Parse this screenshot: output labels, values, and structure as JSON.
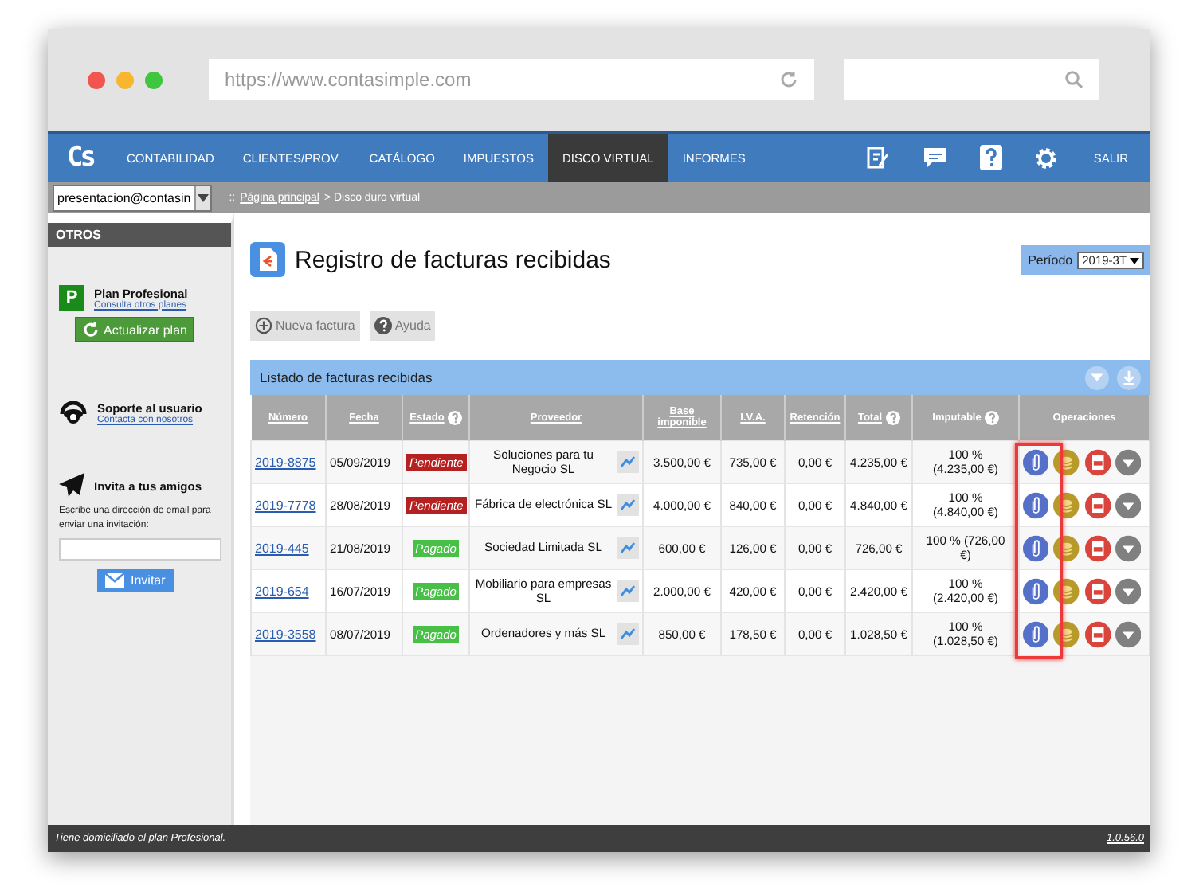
{
  "browser": {
    "url": "https://www.contasimple.com"
  },
  "nav": {
    "logo": "Cs",
    "items": [
      {
        "label": "CONTABILIDAD",
        "selected": false
      },
      {
        "label": "CLIENTES/PROV.",
        "selected": false
      },
      {
        "label": "CATÁLOGO",
        "selected": false
      },
      {
        "label": "IMPUESTOS",
        "selected": false
      },
      {
        "label": "DISCO VIRTUAL",
        "selected": true
      },
      {
        "label": "INFORMES",
        "selected": false
      }
    ],
    "logout": "SALIR"
  },
  "account": "presentacion@contasin",
  "breadcrumb": {
    "prefix": "::",
    "link": "Página principal",
    "rest": "> Disco duro virtual"
  },
  "sidebar": {
    "title": "OTROS",
    "plan": {
      "badge": "P",
      "title": "Plan Profesional",
      "link": "Consulta otros planes",
      "button": "Actualizar plan"
    },
    "support": {
      "title": "Soporte al usuario",
      "link": "Contacta con nosotros"
    },
    "invite": {
      "title": "Invita a tus amigos",
      "text": "Escribe una dirección de email para enviar una invitación:",
      "button": "Invitar"
    }
  },
  "page": {
    "title": "Registro de facturas recibidas",
    "period_label": "Período",
    "period": "2019-3T",
    "actions": [
      "Nueva factura",
      "Ayuda"
    ],
    "list_title": "Listado de facturas recibidas"
  },
  "table": {
    "columns": [
      {
        "label": "Número",
        "help": false
      },
      {
        "label": "Fecha",
        "help": false
      },
      {
        "label": "Estado",
        "help": true
      },
      {
        "label": "Proveedor",
        "help": false
      },
      {
        "label": "Base imponible",
        "help": false
      },
      {
        "label": "I.V.A.",
        "help": false
      },
      {
        "label": "Retención",
        "help": false
      },
      {
        "label": "Total",
        "help": true
      },
      {
        "label": "Imputable",
        "help": true
      },
      {
        "label": "Operaciones",
        "help": false
      }
    ],
    "rows": [
      {
        "number": "2019-8875",
        "date": "05/09/2019",
        "status": "Pendiente",
        "kind": "pending",
        "supplier": "Soluciones para tu Negocio SL",
        "base": "3.500,00 €",
        "iva": "735,00 €",
        "retention": "0,00 €",
        "total": "4.235,00 €",
        "imputable": "100 % (4.235,00 €)"
      },
      {
        "number": "2019-7778",
        "date": "28/08/2019",
        "status": "Pendiente",
        "kind": "pending",
        "supplier": "Fábrica de electrónica SL",
        "base": "4.000,00 €",
        "iva": "840,00 €",
        "retention": "0,00 €",
        "total": "4.840,00 €",
        "imputable": "100 % (4.840,00 €)"
      },
      {
        "number": "2019-445",
        "date": "21/08/2019",
        "status": "Pagado",
        "kind": "paid",
        "supplier": "Sociedad Limitada SL",
        "base": "600,00 €",
        "iva": "126,00 €",
        "retention": "0,00 €",
        "total": "726,00 €",
        "imputable": "100 %  (726,00 €)"
      },
      {
        "number": "2019-654",
        "date": "16/07/2019",
        "status": "Pagado",
        "kind": "paid",
        "supplier": "Mobiliario para empresas SL",
        "base": "2.000,00 €",
        "iva": "420,00 €",
        "retention": "0,00 €",
        "total": "2.420,00 €",
        "imputable": "100 % (2.420,00 €)"
      },
      {
        "number": "2019-3558",
        "date": "08/07/2019",
        "status": "Pagado",
        "kind": "paid",
        "supplier": "Ordenadores y más SL",
        "base": "850,00 €",
        "iva": "178,50 €",
        "retention": "0,00 €",
        "total": "1.028,50 €",
        "imputable": "100 % (1.028,50 €)"
      }
    ]
  },
  "footer": {
    "text": "Tiene domiciliado el plan Profesional.",
    "version": "1.0.56.0"
  }
}
